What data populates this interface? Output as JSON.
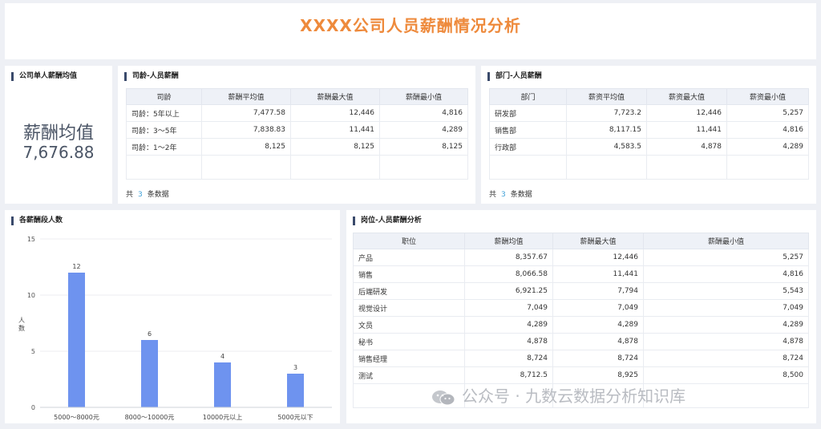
{
  "header": {
    "title": "XXXX公司人员薪酬情况分析"
  },
  "kpi": {
    "title": "公司单人薪酬均值",
    "label": "薪酬均值",
    "value": "7,676.88"
  },
  "tenure": {
    "title": "司龄-人员薪酬",
    "columns": [
      "司龄",
      "薪酬平均值",
      "薪酬最大值",
      "薪酬最小值"
    ],
    "rows": [
      [
        "司龄：5年以上",
        "7,477.58",
        "12,446",
        "4,816"
      ],
      [
        "司龄：3～5年",
        "7,838.83",
        "11,441",
        "4,289"
      ],
      [
        "司龄：1～2年",
        "8,125",
        "8,125",
        "8,125"
      ]
    ],
    "footer": {
      "prefix": "共",
      "count": "3",
      "suffix": "条数据"
    }
  },
  "department": {
    "title": "部门-人员薪酬",
    "columns": [
      "部门",
      "薪资平均值",
      "薪资最大值",
      "薪资最小值"
    ],
    "rows": [
      [
        "研发部",
        "7,723.2",
        "12,446",
        "5,257"
      ],
      [
        "销售部",
        "8,117.15",
        "11,441",
        "4,816"
      ],
      [
        "行政部",
        "4,583.5",
        "4,878",
        "4,289"
      ]
    ],
    "footer": {
      "prefix": "共",
      "count": "3",
      "suffix": "条数据"
    }
  },
  "position": {
    "title": "岗位-人员薪酬分析",
    "columns": [
      "职位",
      "薪酬均值",
      "薪酬最大值",
      "薪酬最小值"
    ],
    "rows": [
      [
        "产品",
        "8,357.67",
        "12,446",
        "5,257"
      ],
      [
        "销售",
        "8,066.58",
        "11,441",
        "4,816"
      ],
      [
        "后端研发",
        "6,921.25",
        "7,794",
        "5,543"
      ],
      [
        "视觉设计",
        "7,049",
        "7,049",
        "7,049"
      ],
      [
        "文员",
        "4,289",
        "4,289",
        "4,289"
      ],
      [
        "秘书",
        "4,878",
        "4,878",
        "4,878"
      ],
      [
        "销售经理",
        "8,724",
        "8,724",
        "8,724"
      ],
      [
        "测试",
        "8,712.5",
        "8,925",
        "8,500"
      ]
    ]
  },
  "watermark": {
    "text": "公众号 · 九数云数据分析知识库"
  },
  "chart_data": {
    "type": "bar",
    "title": "各薪酬段人数",
    "categories": [
      "5000～8000元",
      "8000～10000元",
      "10000元以上",
      "5000元以下"
    ],
    "values": [
      12,
      6,
      4,
      3
    ],
    "ylabel": "人数",
    "xlabel": "",
    "ylim": [
      0,
      15
    ],
    "yticks": [
      0,
      5,
      10,
      15
    ],
    "grid": true,
    "bar_color": "#6e93ef"
  }
}
